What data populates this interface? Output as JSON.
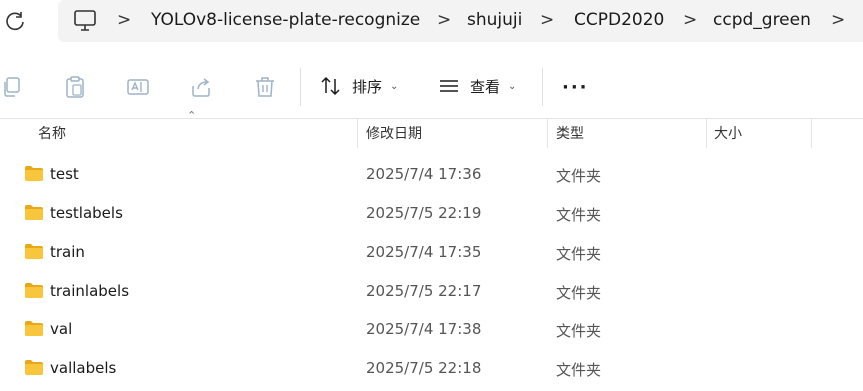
{
  "address": {
    "crumbs": [
      "YOLOv8-license-plate-recognize",
      "shujuji",
      "CCPD2020",
      "ccpd_green"
    ],
    "separator": ">"
  },
  "toolbar": {
    "sort_label": "排序",
    "view_label": "查看",
    "more_label": "···"
  },
  "columns": {
    "name": "名称",
    "modified": "修改日期",
    "type": "类型",
    "size": "大小"
  },
  "files": [
    {
      "name": "test",
      "modified": "2025/7/4 17:36",
      "type": "文件夹"
    },
    {
      "name": "testlabels",
      "modified": "2025/7/5 22:19",
      "type": "文件夹"
    },
    {
      "name": "train",
      "modified": "2025/7/4 17:35",
      "type": "文件夹"
    },
    {
      "name": "trainlabels",
      "modified": "2025/7/5 22:17",
      "type": "文件夹"
    },
    {
      "name": "val",
      "modified": "2025/7/4 17:38",
      "type": "文件夹"
    },
    {
      "name": "vallabels",
      "modified": "2025/7/5 22:18",
      "type": "文件夹"
    }
  ],
  "colors": {
    "folder": "#f8c63d",
    "folder_tab": "#e8a817",
    "icon_disabled": "#9fb4c7"
  }
}
